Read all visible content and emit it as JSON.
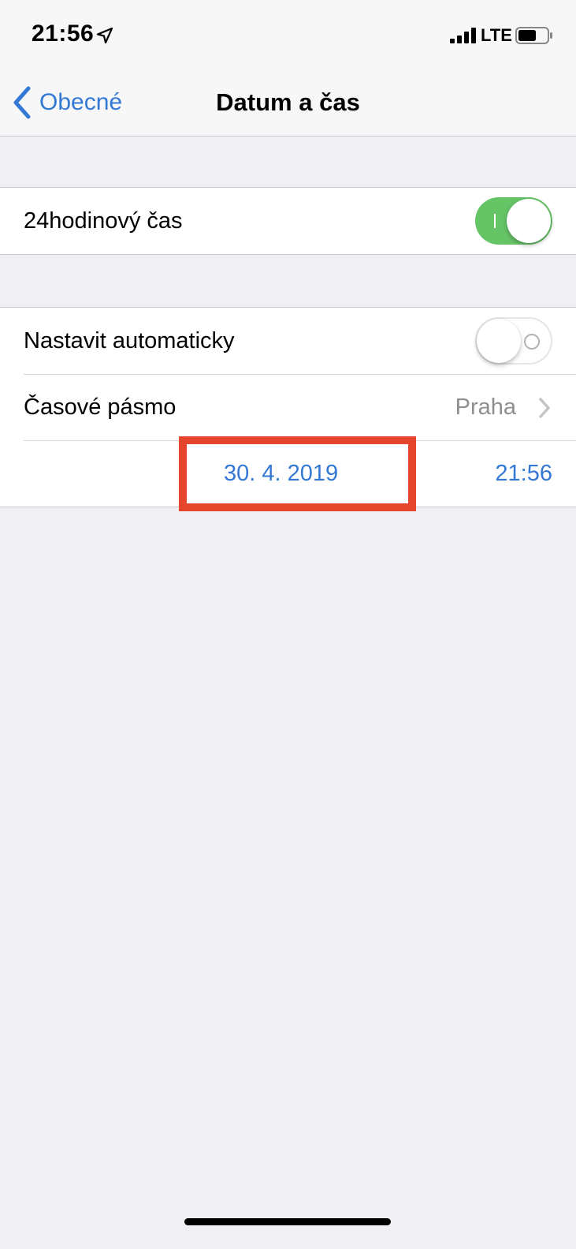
{
  "status_bar": {
    "time": "21:56",
    "network": "LTE"
  },
  "nav": {
    "back_label": "Obecné",
    "title": "Datum a čas"
  },
  "groups": [
    {
      "rows": [
        {
          "label": "24hodinový čas",
          "toggle": true
        }
      ]
    },
    {
      "rows": [
        {
          "label": "Nastavit automaticky",
          "toggle": false
        },
        {
          "label": "Časové pásmo",
          "value": "Praha"
        },
        {
          "date": "30. 4. 2019",
          "time": "21:56"
        }
      ]
    }
  ],
  "colors": {
    "accent": "#3478d5",
    "toggle_on": "#65c466",
    "highlight": "#e5452d",
    "background": "#efeff4"
  }
}
